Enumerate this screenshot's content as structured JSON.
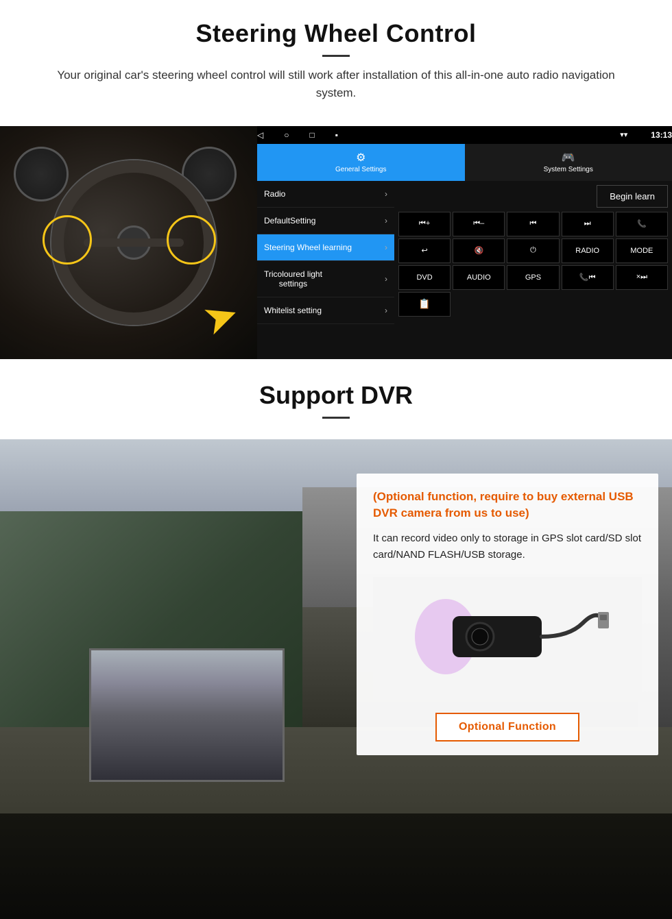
{
  "section1": {
    "title": "Steering Wheel Control",
    "subtitle": "Your original car's steering wheel control will still work after installation of this all-in-one auto radio navigation system."
  },
  "android_ui": {
    "navbar": {
      "back": "◁",
      "home": "○",
      "recent": "□",
      "cast": "▪"
    },
    "status": {
      "signal": "▾",
      "wifi": "▾",
      "time": "13:13"
    },
    "tabs": {
      "general": {
        "icon": "⚙",
        "label": "General Settings"
      },
      "system": {
        "icon": "🎮",
        "label": "System Settings"
      }
    },
    "menu_items": [
      {
        "label": "Radio",
        "active": false
      },
      {
        "label": "DefaultSetting",
        "active": false
      },
      {
        "label": "Steering Wheel learning",
        "active": true
      },
      {
        "label": "Tricoloured light settings",
        "active": false
      },
      {
        "label": "Whitelist setting",
        "active": false
      }
    ],
    "begin_learn": "Begin learn",
    "ctrl_buttons": [
      [
        "⏮+",
        "⏮-",
        "⏮⏮",
        "⏭⏭",
        "📞"
      ],
      [
        "↩",
        "🔇×",
        "⏻",
        "RADIO",
        "MODE"
      ],
      [
        "DVD",
        "AUDIO",
        "GPS",
        "📞⏮",
        "×⏭"
      ],
      [
        "📋"
      ]
    ]
  },
  "section2": {
    "title": "Support DVR",
    "info_box": {
      "optional_text": "(Optional function, require to buy external USB DVR camera from us to use)",
      "description": "It can record video only to storage in GPS slot card/SD slot card/NAND FLASH/USB storage."
    },
    "optional_button": "Optional Function"
  }
}
